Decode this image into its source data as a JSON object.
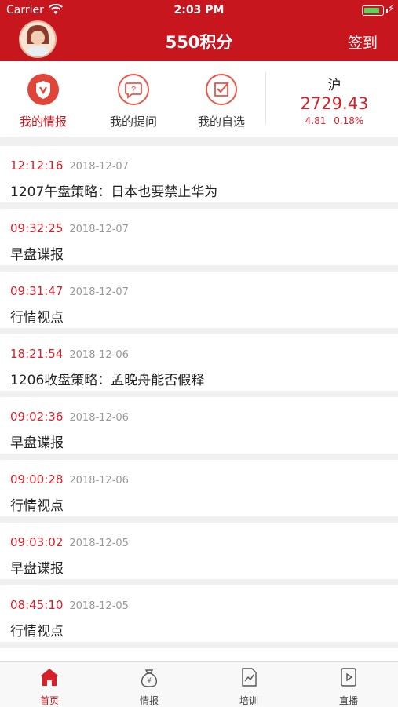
{
  "status_bar": {
    "carrier": "Carrier",
    "time": "2:03 PM",
    "battery_level": 0.85
  },
  "header": {
    "title": "550积分",
    "checkin_label": "签到"
  },
  "quick_actions": [
    {
      "label": "我的情报",
      "icon": "intel-shield-icon",
      "active": true
    },
    {
      "label": "我的提问",
      "icon": "question-icon",
      "active": false
    },
    {
      "label": "我的自选",
      "icon": "checkbox-icon",
      "active": false
    }
  ],
  "market_index": {
    "name": "沪",
    "value": "2729.43",
    "change": "4.81",
    "change_pct": "0.18%"
  },
  "feed": [
    {
      "time": "12:12:16",
      "date": "2018-12-07",
      "title": "1207午盘策略：日本也要禁止华为"
    },
    {
      "time": "09:32:25",
      "date": "2018-12-07",
      "title": "早盘谍报"
    },
    {
      "time": "09:31:47",
      "date": "2018-12-07",
      "title": "行情视点"
    },
    {
      "time": "18:21:54",
      "date": "2018-12-06",
      "title": "1206收盘策略：孟晚舟能否假释"
    },
    {
      "time": "09:02:36",
      "date": "2018-12-06",
      "title": "早盘谍报"
    },
    {
      "time": "09:00:28",
      "date": "2018-12-06",
      "title": "行情视点"
    },
    {
      "time": "09:03:02",
      "date": "2018-12-05",
      "title": "早盘谍报"
    },
    {
      "time": "08:45:10",
      "date": "2018-12-05",
      "title": "行情视点"
    }
  ],
  "tabbar": [
    {
      "label": "首页",
      "icon": "home-icon",
      "active": true
    },
    {
      "label": "情报",
      "icon": "money-bag-icon",
      "active": false
    },
    {
      "label": "培训",
      "icon": "chart-doc-icon",
      "active": false
    },
    {
      "label": "直播",
      "icon": "play-doc-icon",
      "active": false
    }
  ],
  "colors": {
    "brand_red": "#c8161e",
    "accent_red": "#d8202a"
  }
}
